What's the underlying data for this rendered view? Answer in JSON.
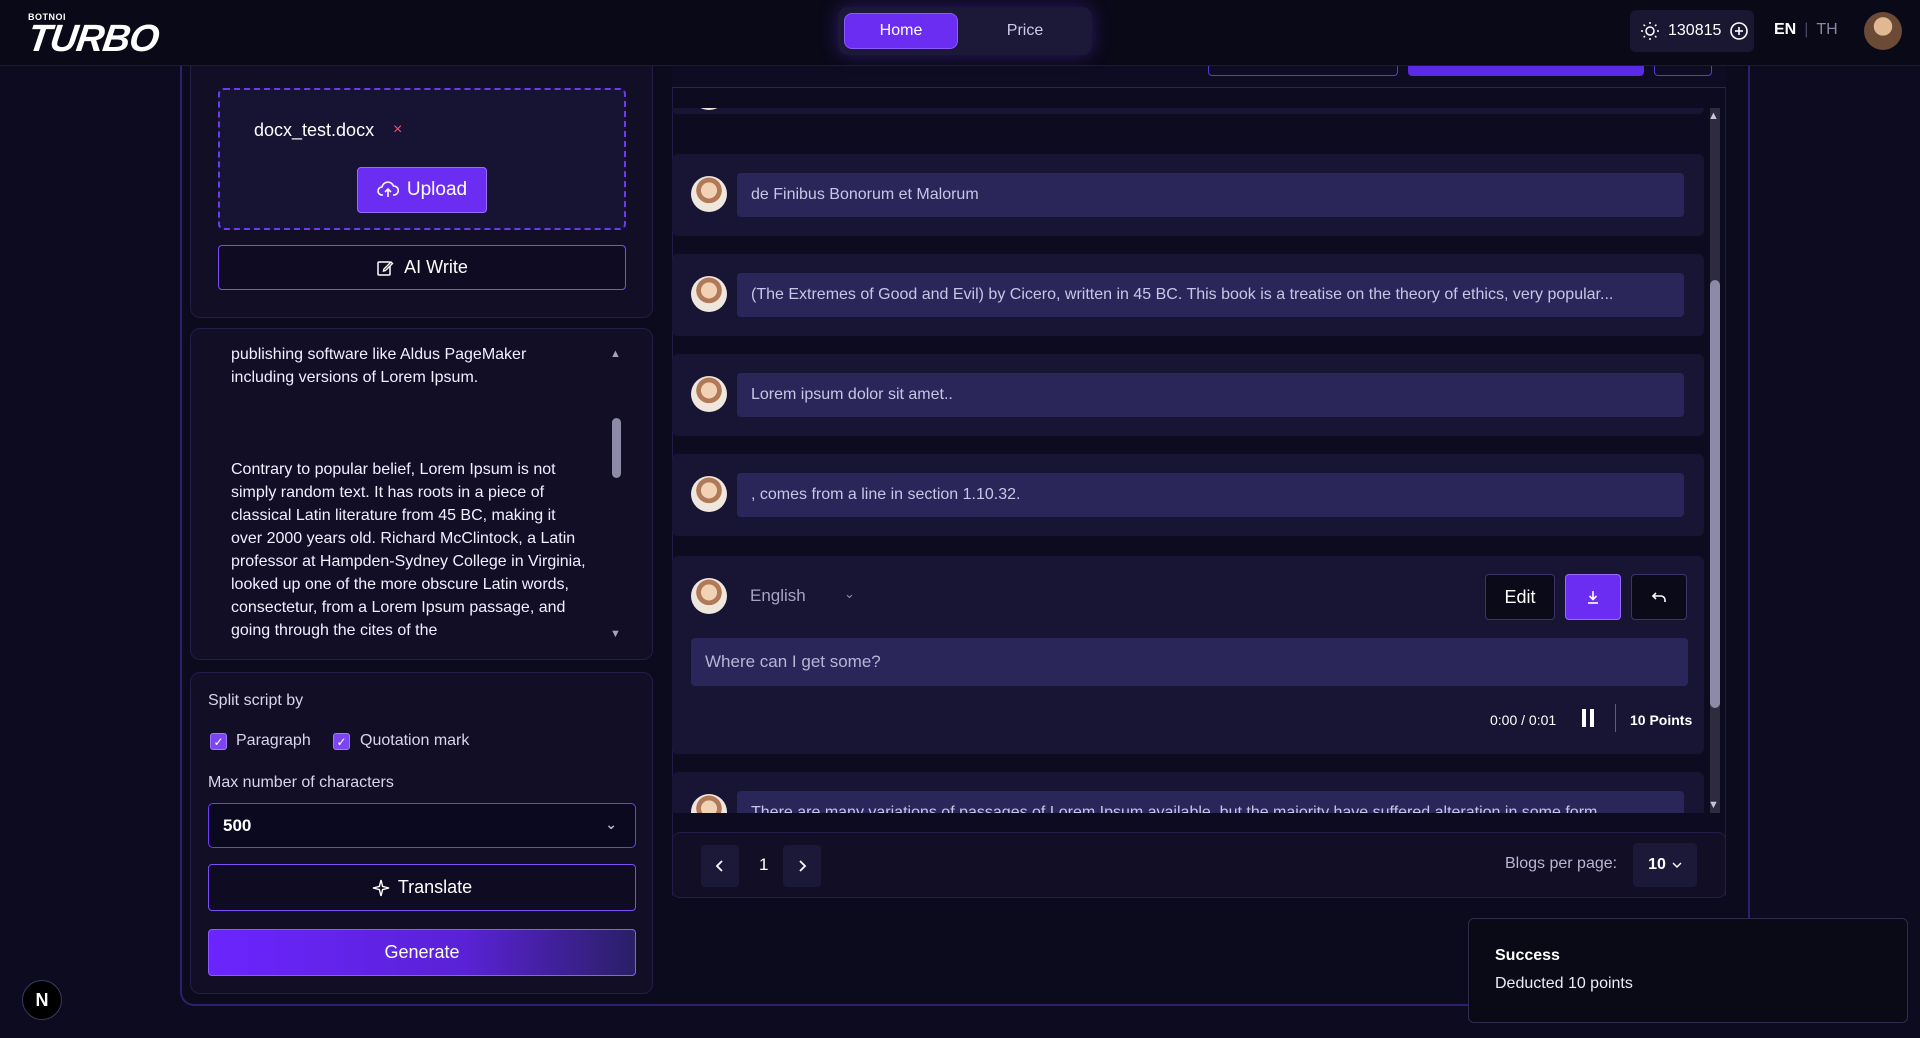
{
  "header": {
    "brand_small": "BOTNOI",
    "brand_big": "TURBO",
    "nav": {
      "home": "Home",
      "price": "Price"
    },
    "points": "130815",
    "lang_en": "EN",
    "lang_th": "TH",
    "lang_sep": "|"
  },
  "upload": {
    "file_name": "docx_test.docx",
    "remove": "×",
    "upload_label": "Upload",
    "ai_write_label": "AI Write"
  },
  "text_preview": {
    "paragraphs": [
      "publishing software like Aldus PageMaker including versions of Lorem Ipsum.",
      "Contrary to popular belief, Lorem Ipsum is not simply random text. It has roots in a piece of classical Latin literature from 45 BC, making it over 2000 years old. Richard McClintock, a Latin professor at Hampden-Sydney College in Virginia, looked up one of the more obscure Latin words, consectetur, from a Lorem Ipsum passage, and going through the cites of the"
    ]
  },
  "settings": {
    "split_label": "Split script by",
    "paragraph_label": "Paragraph",
    "quotation_label": "Quotation mark",
    "max_chars_label": "Max number of characters",
    "max_chars_value": "500",
    "translate_label": "Translate",
    "generate_label": "Generate"
  },
  "blocks": [
    {
      "text": "de Finibus Bonorum et Malorum"
    },
    {
      "text": "(The Extremes of Good and Evil) by Cicero, written in 45 BC. This book is a treatise on the theory of ethics, very popular..."
    },
    {
      "text": "Lorem ipsum dolor sit amet.."
    },
    {
      "text": ", comes from a line in section 1.10.32."
    }
  ],
  "active_block": {
    "language": "English",
    "edit_label": "Edit",
    "input_text": "Where can I get some?",
    "time": "0:00 / 0:01",
    "points": "10 Points"
  },
  "partial_block": {
    "text": "There are many variations of passages of Lorem Ipsum available, but the majority have suffered alteration in some form"
  },
  "pager": {
    "page": "1",
    "per_page_label": "Blogs per page:",
    "per_page_value": "10"
  },
  "toast": {
    "title": "Success",
    "message": "Deducted 10 points"
  },
  "badge": "N",
  "colors": {
    "accent": "#6b2df2",
    "background": "#0d0b1f",
    "field": "#2a2659",
    "danger": "#ff4d6d"
  }
}
